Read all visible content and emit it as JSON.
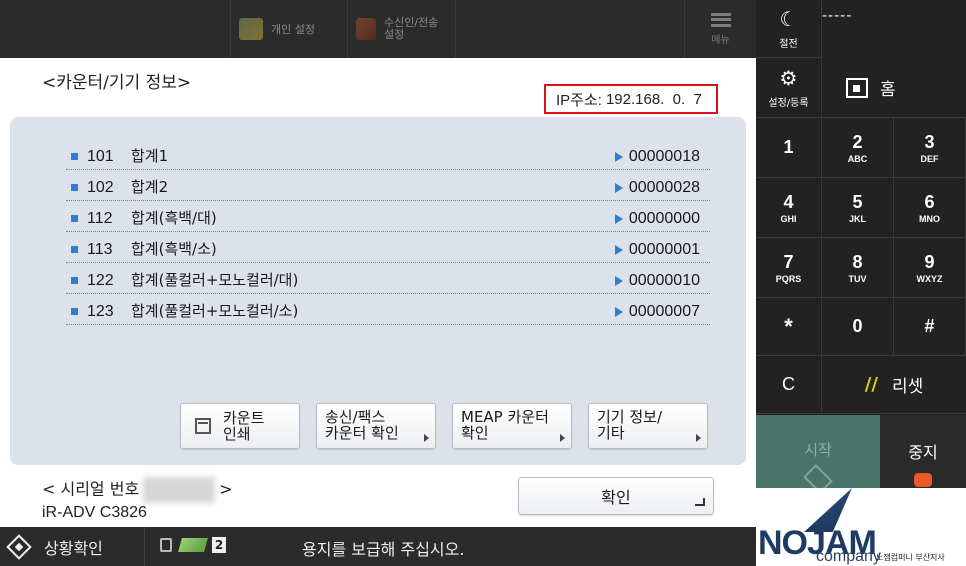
{
  "topbar": {
    "personal_settings": "개인 설정",
    "rx_tx_settings": [
      "수신인/전송",
      "설정"
    ],
    "menu": "메뉴"
  },
  "page": {
    "title": "<카운터/기기 정보>",
    "ip_label": "IP주소:",
    "ip_value": "192.168.  0.  7"
  },
  "counters": [
    {
      "code": "101",
      "name": "합계1",
      "value": "00000018"
    },
    {
      "code": "102",
      "name": "합계2",
      "value": "00000028"
    },
    {
      "code": "112",
      "name": "합계(흑백/대)",
      "value": "00000000"
    },
    {
      "code": "113",
      "name": "합계(흑백/소)",
      "value": "00000001"
    },
    {
      "code": "122",
      "name": "합계(풀컬러+모노컬러/대)",
      "value": "00000010"
    },
    {
      "code": "123",
      "name": "합계(풀컬러+모노컬러/소)",
      "value": "00000007"
    }
  ],
  "buttons": {
    "print_counter": [
      "카운트",
      "인쇄"
    ],
    "send_fax_counter": [
      "송신/팩스",
      "카운터 확인"
    ],
    "meap_counter": [
      "MEAP 카운터",
      "확인"
    ],
    "device_info": [
      "기기 정보/",
      "기타"
    ],
    "ok": "확인"
  },
  "serial": {
    "label_open": "< 시리얼 번호",
    "label_close": ">",
    "model": "iR-ADV C3826"
  },
  "statusbar": {
    "monitor": "상황확인",
    "job_count": "2",
    "message": "용지를 보급해 주십시오."
  },
  "keypad": {
    "sleep": "절전",
    "display_dashes": "-----",
    "settings": "설정/등록",
    "home": "홈",
    "keys": [
      {
        "digit": "1",
        "letters": ""
      },
      {
        "digit": "2",
        "letters": "ABC"
      },
      {
        "digit": "3",
        "letters": "DEF"
      },
      {
        "digit": "4",
        "letters": "GHI"
      },
      {
        "digit": "5",
        "letters": "JKL"
      },
      {
        "digit": "6",
        "letters": "MNO"
      },
      {
        "digit": "7",
        "letters": "PQRS"
      },
      {
        "digit": "8",
        "letters": "TUV"
      },
      {
        "digit": "9",
        "letters": "WXYZ"
      },
      {
        "digit": "*",
        "letters": ""
      },
      {
        "digit": "0",
        "letters": ""
      },
      {
        "digit": "#",
        "letters": ""
      }
    ],
    "clear": "C",
    "reset": "리셋",
    "start": "시작",
    "stop": "중지"
  },
  "logo": {
    "brand": "NOJAM",
    "company": "company",
    "branch": "노잼컴퍼니 부산지사"
  },
  "colors": {
    "accent_blue": "#2f7fd6",
    "highlight_red": "#d8121b",
    "start_green": "#4a7369"
  }
}
